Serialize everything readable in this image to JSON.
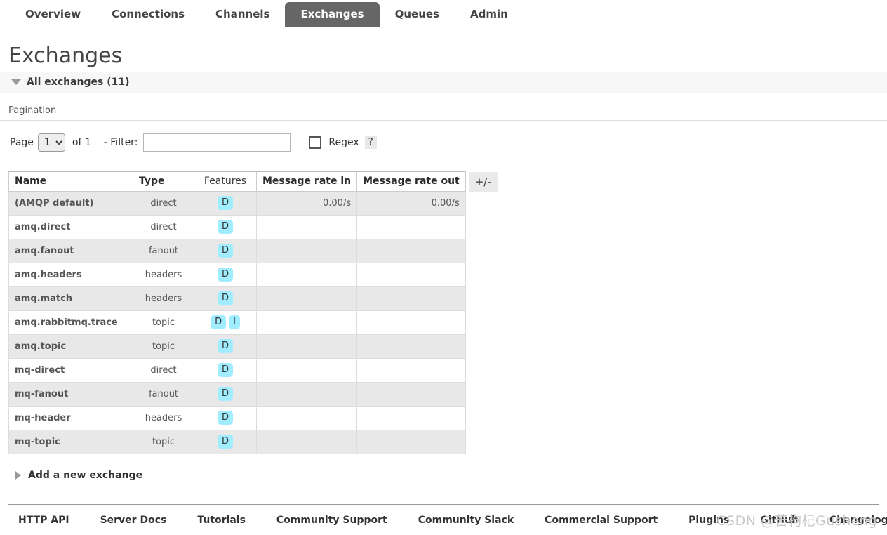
{
  "nav": {
    "tabs": [
      {
        "label": "Overview",
        "active": false
      },
      {
        "label": "Connections",
        "active": false
      },
      {
        "label": "Channels",
        "active": false
      },
      {
        "label": "Exchanges",
        "active": true
      },
      {
        "label": "Queues",
        "active": false
      },
      {
        "label": "Admin",
        "active": false
      }
    ]
  },
  "page": {
    "title": "Exchanges",
    "section_label": "All exchanges (11)"
  },
  "pagination": {
    "title": "Pagination",
    "page_label": "Page",
    "page_value": "1",
    "page_options": [
      "1"
    ],
    "of_label": "of 1",
    "filter_label": "- Filter:",
    "filter_value": "",
    "filter_placeholder": "",
    "regex_label": "Regex",
    "regex_checked": false,
    "help_label": "?"
  },
  "table": {
    "columns": [
      "Name",
      "Type",
      "Features",
      "Message rate in",
      "Message rate out"
    ],
    "toggle_columns_label": "+/-",
    "rows": [
      {
        "name": "(AMQP default)",
        "type": "direct",
        "features": [
          "D"
        ],
        "rate_in": "0.00/s",
        "rate_out": "0.00/s"
      },
      {
        "name": "amq.direct",
        "type": "direct",
        "features": [
          "D"
        ],
        "rate_in": "",
        "rate_out": ""
      },
      {
        "name": "amq.fanout",
        "type": "fanout",
        "features": [
          "D"
        ],
        "rate_in": "",
        "rate_out": ""
      },
      {
        "name": "amq.headers",
        "type": "headers",
        "features": [
          "D"
        ],
        "rate_in": "",
        "rate_out": ""
      },
      {
        "name": "amq.match",
        "type": "headers",
        "features": [
          "D"
        ],
        "rate_in": "",
        "rate_out": ""
      },
      {
        "name": "amq.rabbitmq.trace",
        "type": "topic",
        "features": [
          "D",
          "I"
        ],
        "rate_in": "",
        "rate_out": ""
      },
      {
        "name": "amq.topic",
        "type": "topic",
        "features": [
          "D"
        ],
        "rate_in": "",
        "rate_out": ""
      },
      {
        "name": "mq-direct",
        "type": "direct",
        "features": [
          "D"
        ],
        "rate_in": "",
        "rate_out": ""
      },
      {
        "name": "mq-fanout",
        "type": "fanout",
        "features": [
          "D"
        ],
        "rate_in": "",
        "rate_out": ""
      },
      {
        "name": "mq-header",
        "type": "headers",
        "features": [
          "D"
        ],
        "rate_in": "",
        "rate_out": ""
      },
      {
        "name": "mq-topic",
        "type": "topic",
        "features": [
          "D"
        ],
        "rate_in": "",
        "rate_out": ""
      }
    ]
  },
  "add_exchange": {
    "label": "Add a new exchange"
  },
  "footer": {
    "links": [
      "HTTP API",
      "Server Docs",
      "Tutorials",
      "Community Support",
      "Community Slack",
      "Commercial Support",
      "Plugins",
      "GitHub",
      "Changelog"
    ]
  },
  "watermark": {
    "text": "CSDN @苦枸杞Gusheng"
  },
  "colors": {
    "active_tab_bg": "#666666",
    "feature_badge_bg": "#9fedff",
    "section_bar_bg": "#f7f7f7",
    "row_odd_bg": "#e8e8e8"
  }
}
